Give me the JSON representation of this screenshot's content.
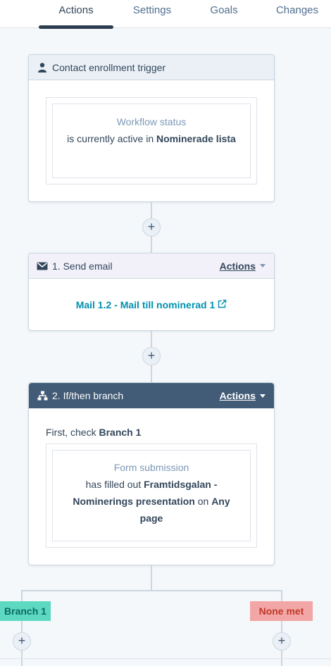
{
  "tabs": [
    {
      "label": "Actions",
      "active": true
    },
    {
      "label": "Settings",
      "active": false
    },
    {
      "label": "Goals",
      "active": false
    },
    {
      "label": "Changes",
      "active": false
    }
  ],
  "trigger": {
    "title": "Contact enrollment trigger",
    "icon": "person-icon",
    "condition_heading": "Workflow status",
    "condition_prefix": "is currently active in",
    "condition_value": "Nominerade lista"
  },
  "step1": {
    "title": "1. Send email",
    "icon": "envelope-icon",
    "actions_label": "Actions",
    "email_link": "Mail 1.2 - Mail till nominerad 1",
    "link_color": "#0091ae"
  },
  "step2": {
    "title": "2. If/then branch",
    "icon": "branch-icon",
    "actions_label": "Actions",
    "check_prefix": "First, check",
    "check_branch": "Branch 1",
    "condition_heading": "Form submission",
    "condition_prefix": "has filled out",
    "condition_form": "Framtidsgalan - Nominerings presentation",
    "condition_on": "on",
    "condition_page": "Any page"
  },
  "branches": [
    {
      "label": "Branch 1",
      "bg": "#5dd9c1",
      "fg": "#0a6b5e"
    },
    {
      "label": "None met",
      "bg": "#f2a6a6",
      "fg": "#c0392b"
    }
  ],
  "add_symbol": "+"
}
